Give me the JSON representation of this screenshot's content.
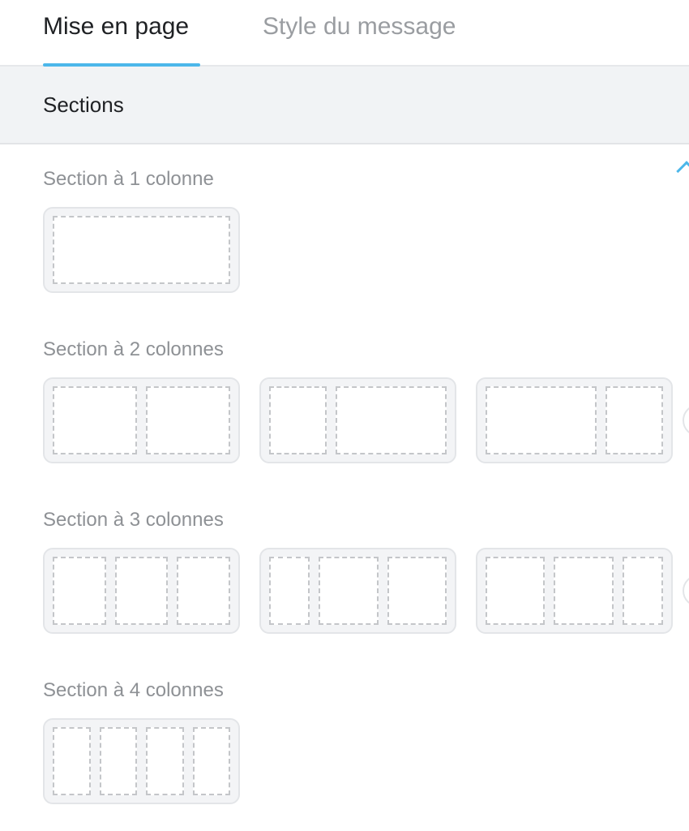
{
  "tabs": [
    {
      "label": "Mise en page",
      "active": true
    },
    {
      "label": "Style du message",
      "active": false
    }
  ],
  "accent_color": "#4cb7ea",
  "panel": {
    "title": "Sections",
    "expanded": true
  },
  "groups": [
    {
      "label": "Section à 1 colonne",
      "layouts": [
        [
          1
        ]
      ]
    },
    {
      "label": "Section à 2 colonnes",
      "layouts": [
        [
          1,
          1
        ],
        [
          1,
          2
        ],
        [
          2,
          1
        ]
      ]
    },
    {
      "label": "Section à 3 colonnes",
      "layouts": [
        [
          1,
          1,
          1
        ],
        [
          2,
          3,
          3
        ],
        [
          3,
          3,
          2
        ]
      ]
    },
    {
      "label": "Section à 4 colonnes",
      "layouts": [
        [
          1,
          1,
          1,
          1
        ]
      ]
    }
  ]
}
